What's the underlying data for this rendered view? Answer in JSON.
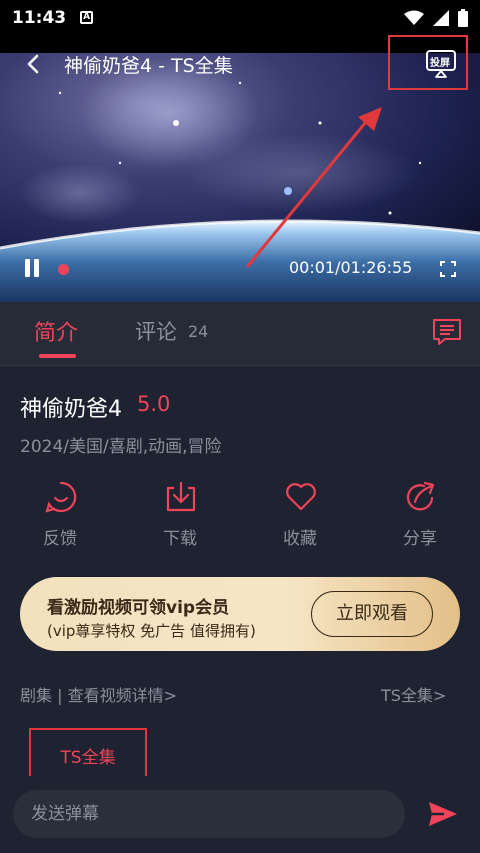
{
  "status_bar": {
    "time": "11:43",
    "notification_icon": "A"
  },
  "player": {
    "title": "神偷奶爸4 - TS全集",
    "cast_label": "投屏",
    "timecode": "00:01/01:26:55",
    "progress_fraction": 0.0002
  },
  "tabs": {
    "intro": "简介",
    "comments": "评论",
    "comments_count": "24"
  },
  "movie": {
    "title": "神偷奶爸4",
    "rating": "5.0",
    "meta": "2024/美国/喜剧,动画,冒险"
  },
  "actions": [
    {
      "label": "反馈",
      "icon": "feedback-icon"
    },
    {
      "label": "下载",
      "icon": "download-icon"
    },
    {
      "label": "收藏",
      "icon": "heart-icon"
    },
    {
      "label": "分享",
      "icon": "share-icon"
    }
  ],
  "vip": {
    "title": "看激励视频可领vip会员",
    "subtitle": "(vip尊享特权 免广告 值得拥有)",
    "button": "立即观看"
  },
  "episodes": {
    "header_left": "剧集 | 查看视频详情>",
    "header_right": "TS全集>",
    "items": [
      "TS全集"
    ]
  },
  "danmaku": {
    "placeholder": "发送弹幕"
  },
  "colors": {
    "accent": "#f1445a",
    "background": "#1f2230",
    "panel": "#272b38",
    "highlight_box": "#e1383c"
  }
}
